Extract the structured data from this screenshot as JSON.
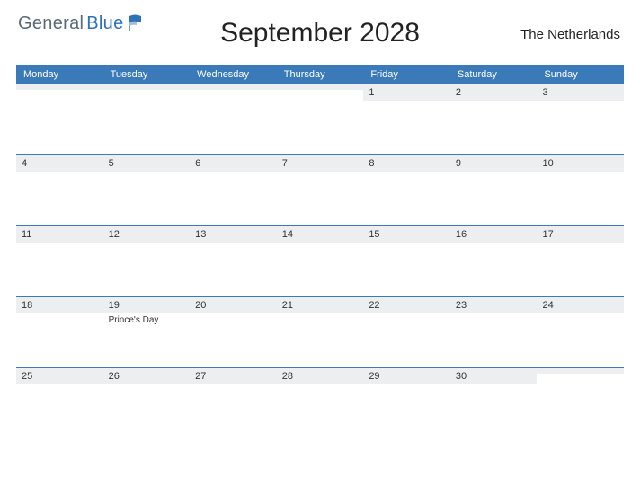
{
  "logo": {
    "part1": "General",
    "part2": "Blue"
  },
  "title": "September 2028",
  "region": "The Netherlands",
  "day_headers": [
    "Monday",
    "Tuesday",
    "Wednesday",
    "Thursday",
    "Friday",
    "Saturday",
    "Sunday"
  ],
  "weeks": [
    [
      {
        "n": "",
        "ev": ""
      },
      {
        "n": "",
        "ev": ""
      },
      {
        "n": "",
        "ev": ""
      },
      {
        "n": "",
        "ev": ""
      },
      {
        "n": "1",
        "ev": ""
      },
      {
        "n": "2",
        "ev": ""
      },
      {
        "n": "3",
        "ev": ""
      }
    ],
    [
      {
        "n": "4",
        "ev": ""
      },
      {
        "n": "5",
        "ev": ""
      },
      {
        "n": "6",
        "ev": ""
      },
      {
        "n": "7",
        "ev": ""
      },
      {
        "n": "8",
        "ev": ""
      },
      {
        "n": "9",
        "ev": ""
      },
      {
        "n": "10",
        "ev": ""
      }
    ],
    [
      {
        "n": "11",
        "ev": ""
      },
      {
        "n": "12",
        "ev": ""
      },
      {
        "n": "13",
        "ev": ""
      },
      {
        "n": "14",
        "ev": ""
      },
      {
        "n": "15",
        "ev": ""
      },
      {
        "n": "16",
        "ev": ""
      },
      {
        "n": "17",
        "ev": ""
      }
    ],
    [
      {
        "n": "18",
        "ev": ""
      },
      {
        "n": "19",
        "ev": "Prince's Day"
      },
      {
        "n": "20",
        "ev": ""
      },
      {
        "n": "21",
        "ev": ""
      },
      {
        "n": "22",
        "ev": ""
      },
      {
        "n": "23",
        "ev": ""
      },
      {
        "n": "24",
        "ev": ""
      }
    ],
    [
      {
        "n": "25",
        "ev": ""
      },
      {
        "n": "26",
        "ev": ""
      },
      {
        "n": "27",
        "ev": ""
      },
      {
        "n": "28",
        "ev": ""
      },
      {
        "n": "29",
        "ev": ""
      },
      {
        "n": "30",
        "ev": ""
      },
      {
        "n": "",
        "ev": ""
      }
    ]
  ]
}
